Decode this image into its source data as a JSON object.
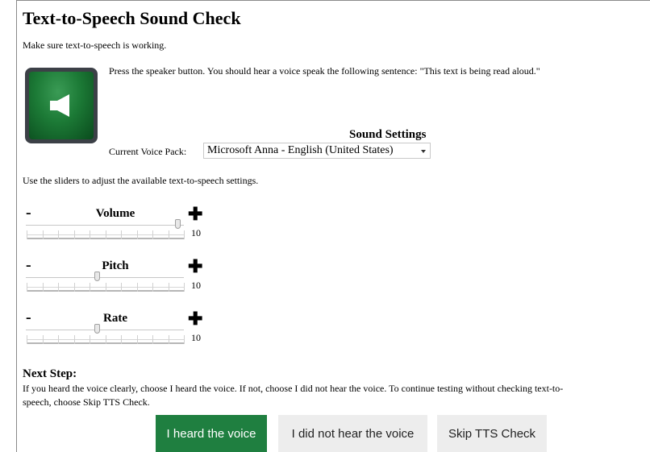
{
  "page": {
    "title": "Text-to-Speech Sound Check",
    "subtitle": "Make sure text-to-speech is working."
  },
  "speaker": {
    "icon": "speaker-icon",
    "instructions": "Press the speaker button. You should hear a voice speak the following sentence: \"This text is being read aloud.\""
  },
  "sound_settings": {
    "heading": "Sound Settings",
    "voice_pack_label": "Current Voice Pack:",
    "voice_pack_selected": "Microsoft Anna - English (United States)"
  },
  "sliders_help": "Use the sliders to adjust the available text-to-speech settings.",
  "sliders": [
    {
      "label": "Volume",
      "minus": "-",
      "plus": "✚",
      "value": "10",
      "level": 0.96
    },
    {
      "label": "Pitch",
      "minus": "-",
      "plus": "✚",
      "value": "10",
      "level": 0.45
    },
    {
      "label": "Rate",
      "minus": "-",
      "plus": "✚",
      "value": "10",
      "level": 0.45
    }
  ],
  "next_step": {
    "heading": "Next Step:",
    "line1": "If you heard the voice clearly, choose I heard the voice. If not, choose I did not hear the voice. To continue testing without checking text-to-",
    "line2": "speech, choose Skip TTS Check."
  },
  "buttons": {
    "heard": "I heard the voice",
    "not_heard": "I did not hear the voice",
    "skip": "Skip TTS Check"
  },
  "colors": {
    "heard_button": "#1f7f40",
    "speaker_green": "#1c7a36",
    "neutral_button": "#ededed"
  }
}
